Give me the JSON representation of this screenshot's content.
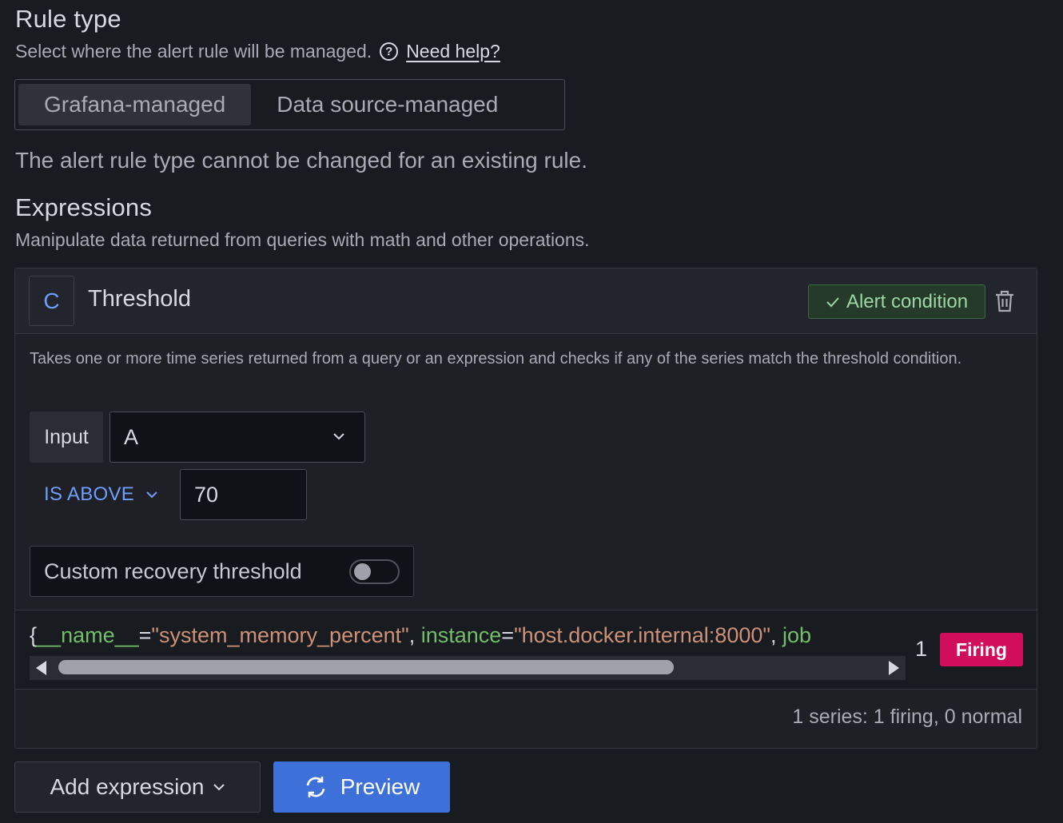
{
  "rule_type": {
    "title": "Rule type",
    "description": "Select where the alert rule will be managed.",
    "help_label": "Need help?",
    "options": [
      {
        "label": "Grafana-managed",
        "active": true
      },
      {
        "label": "Data source-managed",
        "active": false
      }
    ],
    "note": "The alert rule type cannot be changed for an existing rule."
  },
  "expressions": {
    "title": "Expressions",
    "description": "Manipulate data returned from queries with math and other operations."
  },
  "expression": {
    "ref_id": "C",
    "name": "Threshold",
    "alert_condition_label": "Alert condition",
    "description": "Takes one or more time series returned from a query or an expression and checks if any of the series match the threshold condition.",
    "input_label": "Input",
    "input_value": "A",
    "operator": "IS ABOVE",
    "threshold_value": "70",
    "recovery_label": "Custom recovery threshold",
    "recovery_enabled": false
  },
  "series": {
    "open_brace": "{",
    "labels": [
      {
        "key": "__name__",
        "value": "\"system_memory_percent\"",
        "sep": ", "
      },
      {
        "key": "instance",
        "value": "\"host.docker.internal:8000\"",
        "sep": ", "
      },
      {
        "key": "job",
        "value": "",
        "sep": ""
      }
    ],
    "value": "1",
    "state": "Firing",
    "summary": "1 series: 1 firing, 0 normal"
  },
  "buttons": {
    "add_expression": "Add expression",
    "preview": "Preview"
  },
  "colors": {
    "accent_blue": "#6e9fff",
    "primary_button": "#3d71d9",
    "firing": "#d10e5c",
    "label_key": "#73bf69",
    "label_value": "#ce9178"
  }
}
